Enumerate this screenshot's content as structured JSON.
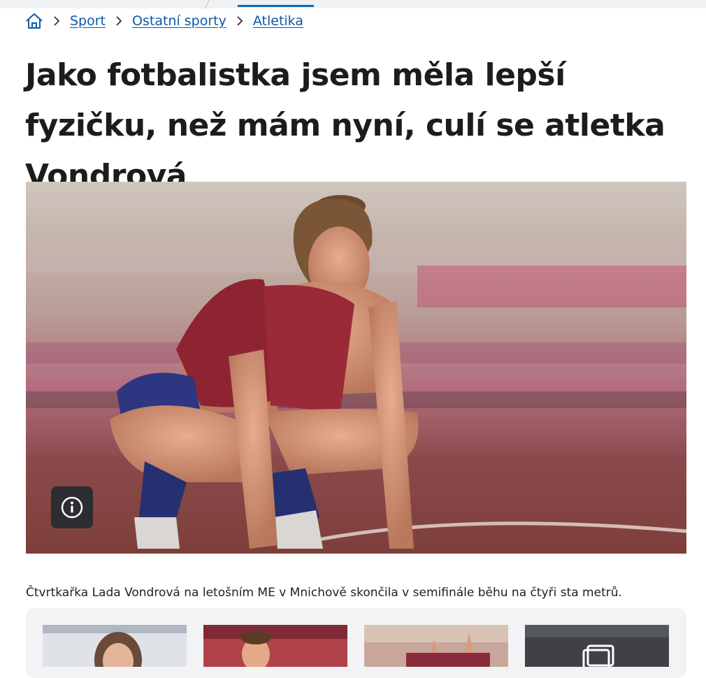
{
  "breadcrumb": {
    "home_icon": "home-icon",
    "separator_icon": "chevron-right-icon",
    "items": [
      "Sport",
      "Ostatní sporty",
      "Atletika"
    ]
  },
  "article": {
    "title": "Jako fotbalistka jsem měla lepší fyzičku, než mám nyní, culí se atletka Vondrová",
    "photo_caption": "Čtvrtkařka Lada Vondrová na letošním ME v Mnichově skončila v semifinále běhu na čtyři sta metrů.",
    "info_icon": "info-icon"
  },
  "colors": {
    "link": "#0b5aa6",
    "accent_tab": "#0b6ab3",
    "info_button_bg": "#2b2d30"
  },
  "gallery": {
    "thumbnail_count_visible": 4,
    "gallery_icon": "gallery-icon"
  }
}
